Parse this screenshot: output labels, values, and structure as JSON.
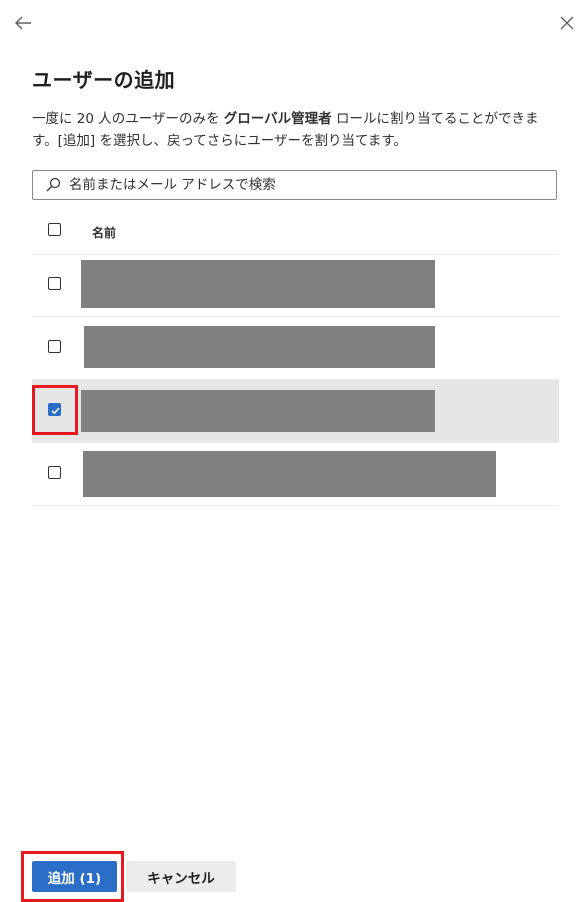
{
  "header": {
    "back_icon": "arrow-left-icon",
    "close_icon": "close-icon",
    "title": "ユーザーの追加"
  },
  "description": {
    "part1": "一度に 20 人のユーザーのみを ",
    "role_name": "グローバル管理者",
    "part2": " ロールに割り当てることができます。[追加] を選択し、戻ってさらにユーザーを割り当てます。"
  },
  "search": {
    "placeholder": "名前またはメール アドレスで検索",
    "icon": "search-icon"
  },
  "table": {
    "column_name": "名前",
    "rows": [
      {
        "checked": false
      },
      {
        "checked": false
      },
      {
        "checked": true
      },
      {
        "checked": false
      }
    ]
  },
  "footer": {
    "add_label": "追加 (1)",
    "cancel_label": "キャンセル"
  },
  "colors": {
    "accent": "#2b6ec7",
    "highlight": "#e8191e",
    "redaction": "#808080",
    "selected_row": "#e6e6e6"
  }
}
